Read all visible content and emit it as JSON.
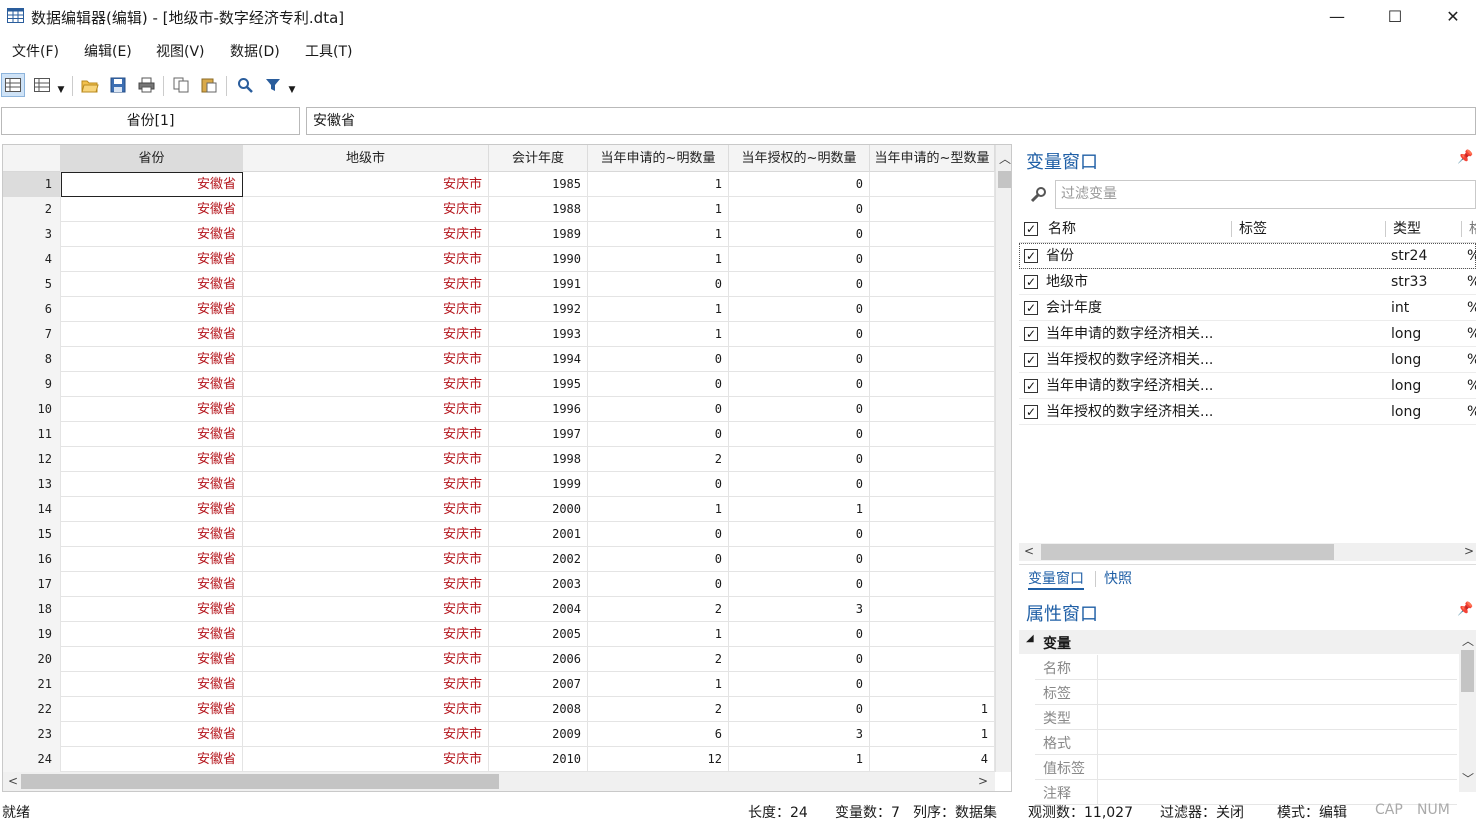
{
  "window": {
    "title": "数据编辑器(编辑) - [地级市-数字经济专利.dta]",
    "minimize": "—",
    "maximize": "☐",
    "close": "✕"
  },
  "menu": [
    "文件(F)",
    "编辑(E)",
    "视图(V)",
    "数据(D)",
    "工具(T)"
  ],
  "editbar": {
    "varname": "省份[1]",
    "value": "安徽省"
  },
  "grid": {
    "columns": [
      "省份",
      "地级市",
      "会计年度",
      "当年申请的~明数量",
      "当年授权的~明数量",
      "当年申请的~型数量"
    ],
    "rows": [
      [
        "1",
        "安徽省",
        "安庆市",
        "1985",
        "1",
        "0",
        ""
      ],
      [
        "2",
        "安徽省",
        "安庆市",
        "1988",
        "1",
        "0",
        ""
      ],
      [
        "3",
        "安徽省",
        "安庆市",
        "1989",
        "1",
        "0",
        ""
      ],
      [
        "4",
        "安徽省",
        "安庆市",
        "1990",
        "1",
        "0",
        ""
      ],
      [
        "5",
        "安徽省",
        "安庆市",
        "1991",
        "0",
        "0",
        ""
      ],
      [
        "6",
        "安徽省",
        "安庆市",
        "1992",
        "1",
        "0",
        ""
      ],
      [
        "7",
        "安徽省",
        "安庆市",
        "1993",
        "1",
        "0",
        ""
      ],
      [
        "8",
        "安徽省",
        "安庆市",
        "1994",
        "0",
        "0",
        ""
      ],
      [
        "9",
        "安徽省",
        "安庆市",
        "1995",
        "0",
        "0",
        ""
      ],
      [
        "10",
        "安徽省",
        "安庆市",
        "1996",
        "0",
        "0",
        ""
      ],
      [
        "11",
        "安徽省",
        "安庆市",
        "1997",
        "0",
        "0",
        ""
      ],
      [
        "12",
        "安徽省",
        "安庆市",
        "1998",
        "2",
        "0",
        ""
      ],
      [
        "13",
        "安徽省",
        "安庆市",
        "1999",
        "0",
        "0",
        ""
      ],
      [
        "14",
        "安徽省",
        "安庆市",
        "2000",
        "1",
        "1",
        ""
      ],
      [
        "15",
        "安徽省",
        "安庆市",
        "2001",
        "0",
        "0",
        ""
      ],
      [
        "16",
        "安徽省",
        "安庆市",
        "2002",
        "0",
        "0",
        ""
      ],
      [
        "17",
        "安徽省",
        "安庆市",
        "2003",
        "0",
        "0",
        ""
      ],
      [
        "18",
        "安徽省",
        "安庆市",
        "2004",
        "2",
        "3",
        ""
      ],
      [
        "19",
        "安徽省",
        "安庆市",
        "2005",
        "1",
        "0",
        ""
      ],
      [
        "20",
        "安徽省",
        "安庆市",
        "2006",
        "2",
        "0",
        ""
      ],
      [
        "21",
        "安徽省",
        "安庆市",
        "2007",
        "1",
        "0",
        ""
      ],
      [
        "22",
        "安徽省",
        "安庆市",
        "2008",
        "2",
        "0",
        "1"
      ],
      [
        "23",
        "安徽省",
        "安庆市",
        "2009",
        "6",
        "3",
        "1"
      ],
      [
        "24",
        "安徽省",
        "安庆市",
        "2010",
        "12",
        "1",
        "4"
      ]
    ]
  },
  "var_window": {
    "title": "变量窗口",
    "filter_placeholder": "过滤变量",
    "headers": {
      "name": "名称",
      "label": "标签",
      "type": "类型",
      "format": "格"
    },
    "variables": [
      {
        "name": "省份",
        "type": "str24",
        "fmt": "%"
      },
      {
        "name": "地级市",
        "type": "str33",
        "fmt": "%"
      },
      {
        "name": "会计年度",
        "type": "int",
        "fmt": "%"
      },
      {
        "name": "当年申请的数字经济相关...",
        "type": "long",
        "fmt": "%"
      },
      {
        "name": "当年授权的数字经济相关...",
        "type": "long",
        "fmt": "%"
      },
      {
        "name": "当年申请的数字经济相关...",
        "type": "long",
        "fmt": "%"
      },
      {
        "name": "当年授权的数字经济相关...",
        "type": "long",
        "fmt": "%"
      }
    ],
    "tabs": [
      "变量窗口",
      "快照"
    ]
  },
  "prop_window": {
    "title": "属性窗口",
    "section": "变量",
    "fields": [
      "名称",
      "标签",
      "类型",
      "格式",
      "值标签",
      "注释"
    ]
  },
  "status": {
    "ready": "就绪",
    "length": "长度：24",
    "vars": "变量数：7",
    "order": "列序：数据集",
    "obs": "观测数：11,027",
    "filter": "过滤器：关闭",
    "mode": "模式：编辑",
    "cap": "CAP",
    "num": "NUM"
  },
  "colors": {
    "string_text": "#b4151c",
    "panel_title": "#1f5fa6"
  }
}
